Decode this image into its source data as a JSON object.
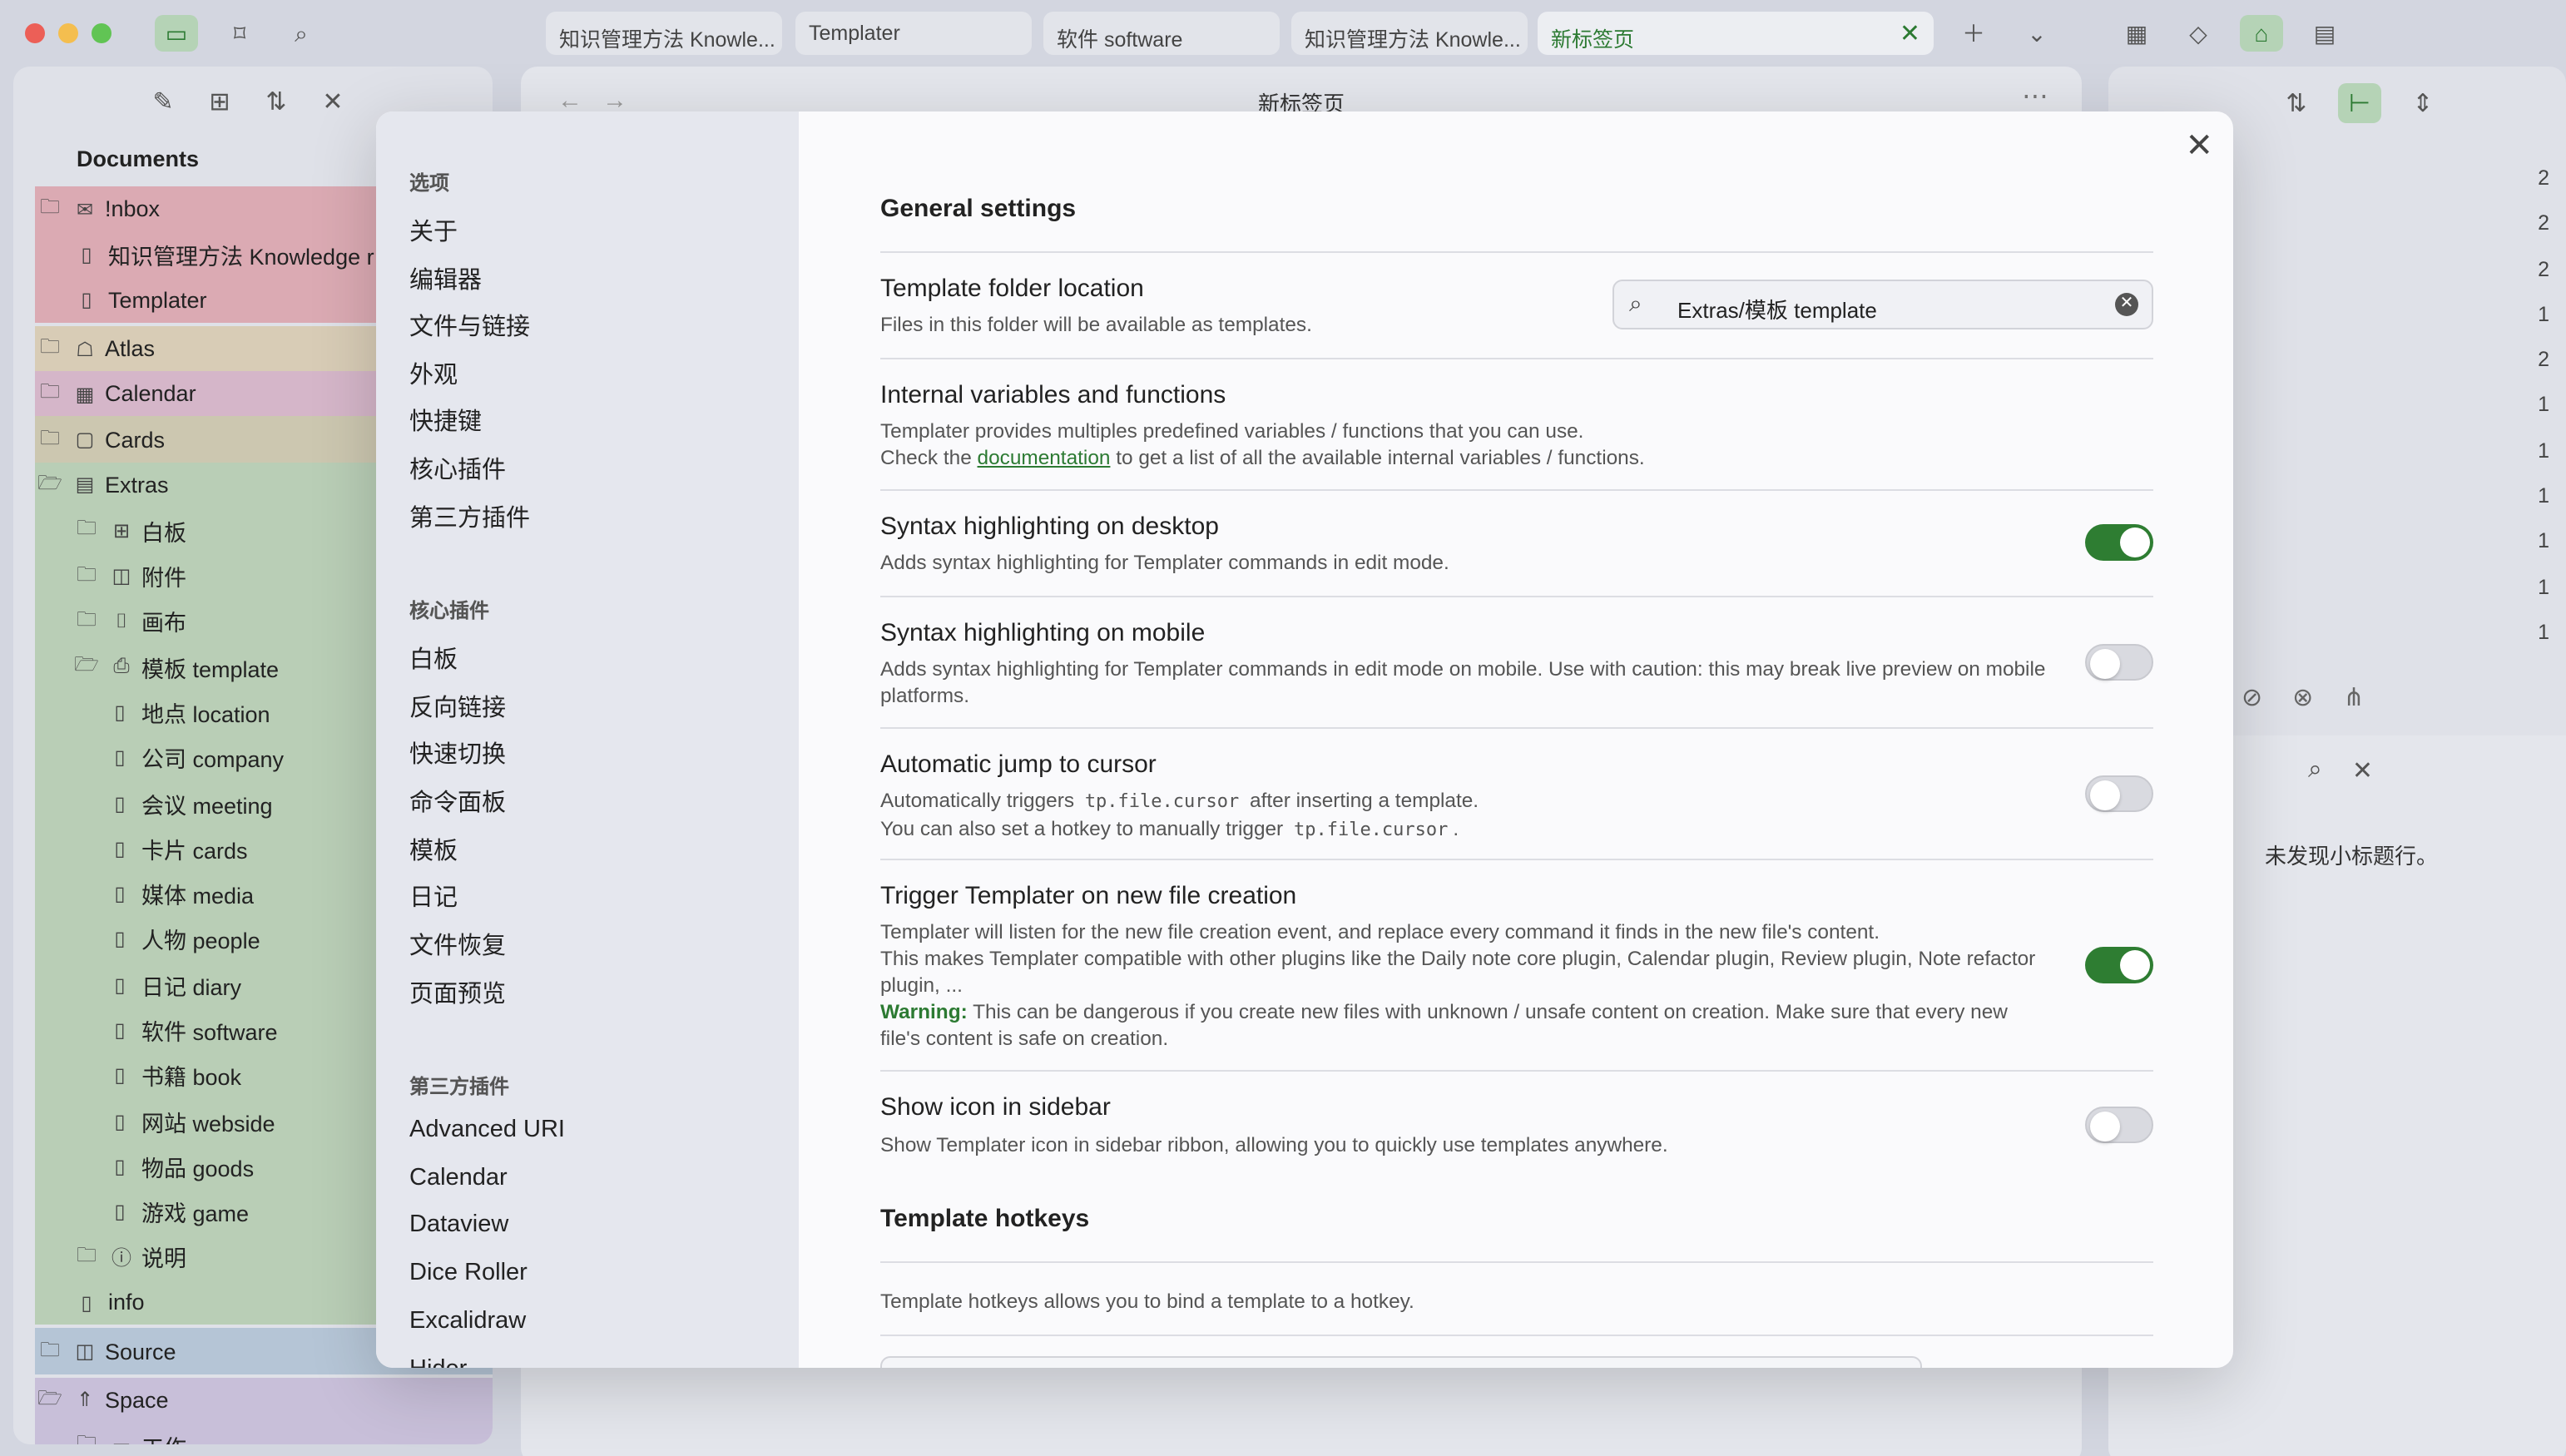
{
  "tabs": [
    {
      "label": "知识管理方法 Knowle..."
    },
    {
      "label": "Templater"
    },
    {
      "label": "软件 software"
    },
    {
      "label": "知识管理方法 Knowle..."
    },
    {
      "label": "新标签页"
    }
  ],
  "sidebar": {
    "title": "Documents",
    "items": [
      {
        "label": "!nbox"
      },
      {
        "label": "知识管理方法 Knowledge r"
      },
      {
        "label": "Templater"
      },
      {
        "label": "Atlas"
      },
      {
        "label": "Calendar"
      },
      {
        "label": "Cards"
      },
      {
        "label": "Extras"
      },
      {
        "label": "白板"
      },
      {
        "label": "附件"
      },
      {
        "label": "画布"
      },
      {
        "label": "模板 template"
      },
      {
        "label": "地点 location"
      },
      {
        "label": "公司 company"
      },
      {
        "label": "会议 meeting"
      },
      {
        "label": "卡片 cards"
      },
      {
        "label": "媒体 media"
      },
      {
        "label": "人物 people"
      },
      {
        "label": "日记 diary"
      },
      {
        "label": "软件 software"
      },
      {
        "label": "书籍 book"
      },
      {
        "label": "网站 webside"
      },
      {
        "label": "物品 goods"
      },
      {
        "label": "游戏 game"
      },
      {
        "label": "说明"
      },
      {
        "label": "info"
      },
      {
        "label": "Source"
      },
      {
        "label": "Space"
      },
      {
        "label": "工作"
      }
    ]
  },
  "main": {
    "title": "新标签页"
  },
  "right": {
    "counts": [
      "2",
      "2",
      "2",
      "1",
      "2",
      "1",
      "1",
      "1",
      "1",
      "1",
      "1"
    ],
    "empty_text": "未发现小标题行。"
  },
  "modal": {
    "nav": {
      "group1": "选项",
      "options": [
        "关于",
        "编辑器",
        "文件与链接",
        "外观",
        "快捷键",
        "核心插件",
        "第三方插件"
      ],
      "group2": "核心插件",
      "core": [
        "白板",
        "反向链接",
        "快速切换",
        "命令面板",
        "模板",
        "日记",
        "文件恢复",
        "页面预览"
      ],
      "group3": "第三方插件",
      "community": [
        "Advanced URI",
        "Calendar",
        "Dataview",
        "Dice Roller",
        "Excalidraw",
        "Hider"
      ]
    },
    "general_title": "General settings",
    "folder": {
      "name": "Template folder location",
      "desc": "Files in this folder will be available as templates.",
      "value": "Extras/模板 template"
    },
    "internal": {
      "name": "Internal variables and functions",
      "desc1": "Templater provides multiples predefined variables / functions that you can use.",
      "desc2_pre": "Check the",
      "desc2_link": "documentation",
      "desc2_post": "to get a list of all the available internal variables / functions."
    },
    "syntax_desktop": {
      "name": "Syntax highlighting on desktop",
      "desc": "Adds syntax highlighting for Templater commands in edit mode.",
      "on": true
    },
    "syntax_mobile": {
      "name": "Syntax highlighting on mobile",
      "desc": "Adds syntax highlighting for Templater commands in edit mode on mobile. Use with caution: this may break live preview on mobile platforms.",
      "on": false
    },
    "auto_jump": {
      "name": "Automatic jump to cursor",
      "desc1_pre": "Automatically triggers",
      "code": "tp.file.cursor",
      "desc1_post": "after inserting a template.",
      "desc2_pre": "You can also set a hotkey to manually trigger",
      "desc2_post": ".",
      "on": false
    },
    "trigger": {
      "name": "Trigger Templater on new file creation",
      "desc1": "Templater will listen for the new file creation event, and replace every command it finds in the new file's content.",
      "desc2": "This makes Templater compatible with other plugins like the Daily note core plugin, Calendar plugin, Review plugin, Note refactor plugin, ...",
      "warn_label": "Warning:",
      "warn_text": "This can be dangerous if you create new files with unknown / unsafe content on creation. Make sure that every new file's content is safe on creation.",
      "on": true
    },
    "sidebar_icon": {
      "name": "Show icon in sidebar",
      "desc": "Show Templater icon in sidebar ribbon, allowing you to quickly use templates anywhere.",
      "on": false
    },
    "hotkeys_title": "Template hotkeys",
    "hotkeys_desc": "Template hotkeys allows you to bind a template to a hotkey."
  }
}
